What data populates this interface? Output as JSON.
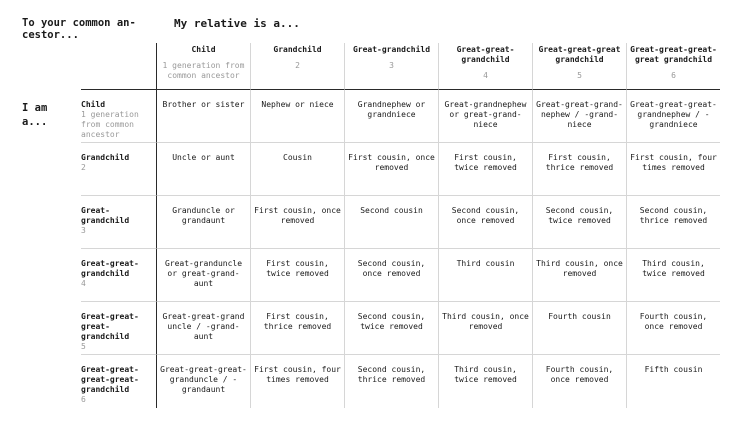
{
  "corner_label": "To your common an- cestor...",
  "top_heading": "My relative is a...",
  "side_heading": "I am a...",
  "columns": [
    {
      "title": "Child",
      "sub": "1 generation from common ancestor"
    },
    {
      "title": "Grandchild",
      "sub": "2"
    },
    {
      "title": "Great-grandchild",
      "sub": "3"
    },
    {
      "title": "Great-great-grandchild",
      "sub": "4"
    },
    {
      "title": "Great-great-great grandchild",
      "sub": "5"
    },
    {
      "title": "Great-great-great-great grandchild",
      "sub": "6"
    }
  ],
  "rows": [
    {
      "title": "Child",
      "sub": "1 generation from common ancestor",
      "cells": [
        "Brother or sister",
        "Nephew or niece",
        "Grandnephew or grandniece",
        "Great-grandnephew or great-grand-niece",
        "Great-great-grand-nephew / -grand-niece",
        "Great-great-great-grandnephew / -grandniece"
      ]
    },
    {
      "title": "Grandchild",
      "sub": "2",
      "cells": [
        "Uncle or aunt",
        "Cousin",
        "First cousin, once removed",
        "First cousin, twice removed",
        "First cousin, thrice removed",
        "First cousin, four times removed"
      ]
    },
    {
      "title": "Great-grandchild",
      "sub": "3",
      "cells": [
        "Granduncle or grandaunt",
        "First cousin, once removed",
        "Second cousin",
        "Second cousin, once removed",
        "Second cousin, twice removed",
        "Second cousin, thrice removed"
      ]
    },
    {
      "title": "Great-great-grandchild",
      "sub": "4",
      "cells": [
        "Great-granduncle or great-grand-aunt",
        "First cousin, twice removed",
        "Second cousin, once removed",
        "Third cousin",
        "Third cousin, once removed",
        "Third cousin, twice removed"
      ]
    },
    {
      "title": "Great-great-great-grandchild",
      "sub": "5",
      "cells": [
        "Great-great-grand uncle / -grand-aunt",
        "First cousin, thrice removed",
        "Second cousin, twice removed",
        "Third cousin, once removed",
        "Fourth cousin",
        "Fourth cousin, once removed"
      ]
    },
    {
      "title": "Great-great-great-great-grandchild",
      "sub": "6",
      "cells": [
        "Great-great-great-granduncle / -grandaunt",
        "First cousin, four times removed",
        "Second cousin, thrice removed",
        "Third cousin, twice removed",
        "Fourth cousin, once removed",
        "Fifth cousin"
      ]
    }
  ]
}
